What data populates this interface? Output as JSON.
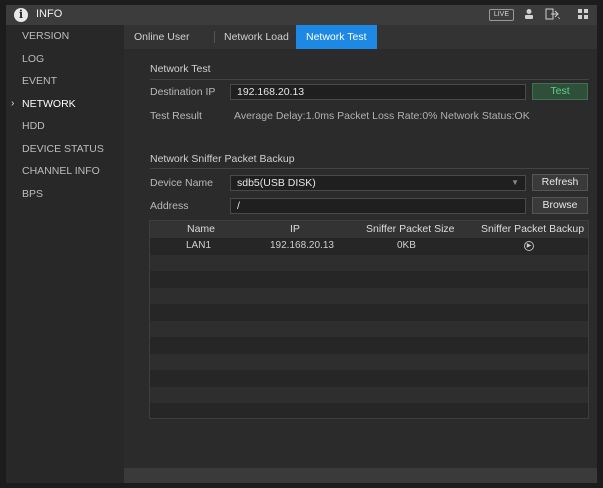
{
  "header": {
    "title": "INFO",
    "live_badge": "LIVE",
    "icons": [
      "info-icon",
      "user-icon",
      "logout-icon",
      "grid-icon"
    ]
  },
  "sidebar": {
    "items": [
      {
        "label": "VERSION"
      },
      {
        "label": "LOG"
      },
      {
        "label": "EVENT"
      },
      {
        "label": "NETWORK",
        "active": true,
        "arrow": "›"
      },
      {
        "label": "HDD"
      },
      {
        "label": "DEVICE STATUS"
      },
      {
        "label": "CHANNEL INFO"
      },
      {
        "label": "BPS"
      }
    ]
  },
  "tabs": [
    {
      "label": "Online User"
    },
    {
      "label": "Network Load"
    },
    {
      "label": "Network Test",
      "active": true
    }
  ],
  "network_test": {
    "section_title": "Network Test",
    "dest_ip_label": "Destination IP",
    "dest_ip_value": "192.168.20.13",
    "test_button": "Test",
    "result_label": "Test Result",
    "result_value": "Average Delay:1.0ms  Packet Loss Rate:0%  Network Status:OK"
  },
  "sniffer": {
    "section_title": "Network Sniffer Packet Backup",
    "device_label": "Device Name",
    "device_value": "sdb5(USB DISK)",
    "refresh_button": "Refresh",
    "address_label": "Address",
    "address_value": "/",
    "browse_button": "Browse"
  },
  "table": {
    "columns": [
      "Name",
      "IP",
      "Sniffer Packet Size",
      "Sniffer Packet Backup"
    ],
    "rows": [
      {
        "name": "LAN1",
        "ip": "192.168.20.13",
        "size": "0KB",
        "backup_icon": "play-circle-icon"
      }
    ]
  },
  "colors": {
    "accent": "#1e88e5",
    "test_button_text": "#5fd08a",
    "background": "#1c1c1c",
    "panel": "#2b2b2b"
  }
}
